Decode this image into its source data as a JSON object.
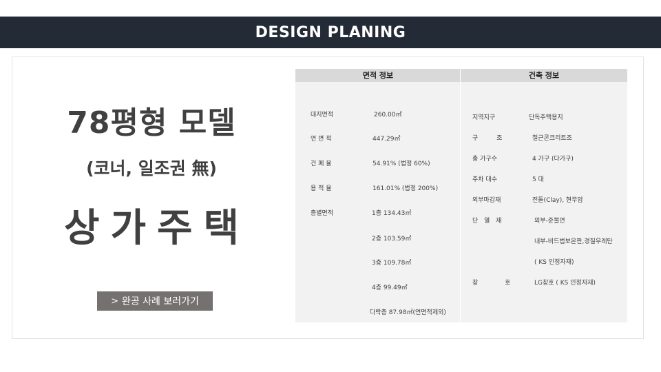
{
  "header": {
    "title": "DESIGN PLANING"
  },
  "hero": {
    "model_title": "78평형 모델",
    "model_subtitle": "(코너, 일조권 無)",
    "building_type": "상가주택",
    "cases_button_label": "완공 사례 보러가기",
    "cases_button_icon": "chevron-right-icon"
  },
  "area_info": {
    "header": "면적 정보",
    "rows": [
      {
        "label": "대지면적",
        "value": "260.00㎡"
      },
      {
        "label": "연 면 적",
        "value": "447.29㎡"
      },
      {
        "label": "건 폐 율",
        "value": "54.91% (법정 60%)"
      },
      {
        "label": "용 적 율",
        "value": "161.01% (법정 200%)"
      },
      {
        "label": "층별면적",
        "value": "1층 134.43㎡"
      },
      {
        "label": "",
        "value": "2층 103.59㎡"
      },
      {
        "label": "",
        "value": "3층 109.78㎡"
      },
      {
        "label": "",
        "value": "4층 99.49㎡"
      },
      {
        "label": "",
        "value": "다락층 87.98㎡(연면적제외)"
      }
    ]
  },
  "building_info": {
    "header": "건축 정보",
    "rows": [
      {
        "label": "지역지구",
        "value": "단독주택용지"
      },
      {
        "label": "구 조",
        "value": "철근콘크리트조"
      },
      {
        "label": "총 가구수",
        "value": "4 가구 (다가구)"
      },
      {
        "label": "주차 대수",
        "value": "5 대"
      },
      {
        "label": "외부마감재",
        "value": "전돌(Clay), 현무암"
      },
      {
        "label": "단 열 재",
        "value": "외부-준불연"
      },
      {
        "label": "",
        "value": "내부-비드법보온판,경질우레탄"
      },
      {
        "label": "",
        "value": "( KS 인정자재)"
      },
      {
        "label": "창 호",
        "value": "LG창호 ( KS 인정자재)"
      }
    ]
  },
  "colors": {
    "header_bar": "#232b36",
    "panel_bg": "#f2f2f2",
    "panel_header_bg": "#d9d9d9",
    "button_bg": "#767171",
    "title_text": "#404040"
  }
}
